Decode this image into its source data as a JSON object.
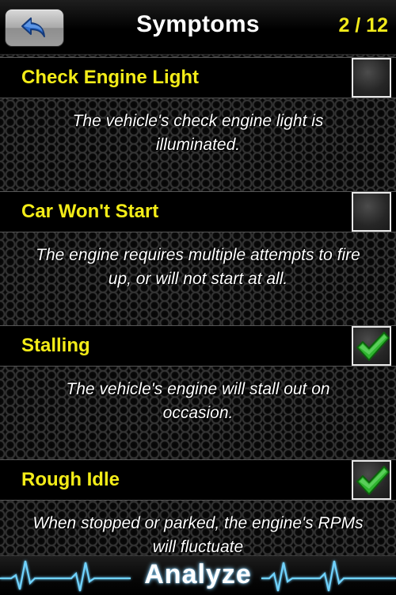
{
  "header": {
    "title": "Symptoms",
    "counter": "2 / 12",
    "back_icon": "back-arrow-icon"
  },
  "symptoms": [
    {
      "title": "Check Engine Light",
      "description": "The vehicle's check engine light is illuminated.",
      "checked": false
    },
    {
      "title": "Car Won't Start",
      "description": "The engine requires multiple attempts to fire up, or will not start at all.",
      "checked": false
    },
    {
      "title": "Stalling",
      "description": "The vehicle's engine will stall out on occasion.",
      "checked": true
    },
    {
      "title": "Rough Idle",
      "description": "When stopped or parked, the engine's RPMs will fluctuate",
      "checked": true
    }
  ],
  "footer": {
    "label": "Analyze",
    "icon": "heartbeat-icon"
  },
  "colors": {
    "title_yellow": "#f3ec18",
    "check_green": "#3cc83c",
    "glow_blue": "#8fd6ff"
  }
}
